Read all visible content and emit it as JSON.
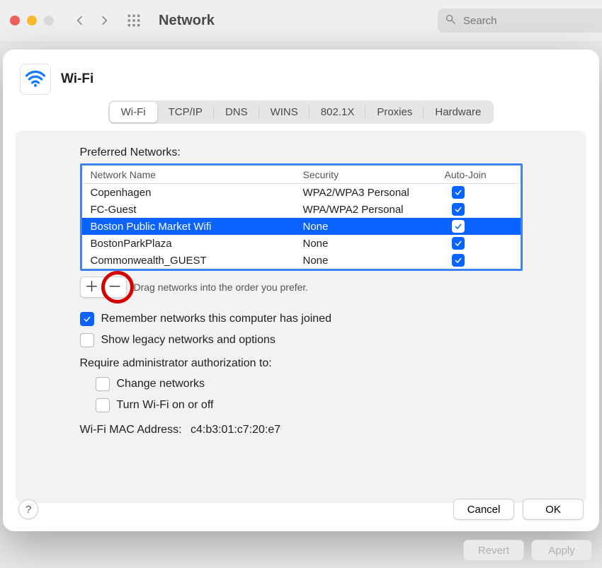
{
  "toolbar": {
    "title": "Network",
    "search_placeholder": "Search"
  },
  "sheet": {
    "title": "Wi-Fi",
    "tabs": [
      "Wi-Fi",
      "TCP/IP",
      "DNS",
      "WINS",
      "802.1X",
      "Proxies",
      "Hardware"
    ],
    "tabIndex": 0,
    "preferred_label": "Preferred Networks:",
    "columns": {
      "name": "Network Name",
      "security": "Security",
      "autojoin": "Auto-Join"
    },
    "networks": [
      {
        "name": "Copenhagen",
        "security": "WPA2/WPA3 Personal",
        "autojoin": true,
        "selected": false
      },
      {
        "name": "FC-Guest",
        "security": "WPA/WPA2 Personal",
        "autojoin": true,
        "selected": false
      },
      {
        "name": "Boston Public Market Wifi",
        "security": "None",
        "autojoin": true,
        "selected": true
      },
      {
        "name": "BostonParkPlaza",
        "security": "None",
        "autojoin": true,
        "selected": false
      },
      {
        "name": "Commonwealth_GUEST",
        "security": "None",
        "autojoin": true,
        "selected": false
      }
    ],
    "drag_hint": "Drag networks into the order you prefer.",
    "remember_label": "Remember networks this computer has joined",
    "remember_checked": true,
    "legacy_label": "Show legacy networks and options",
    "legacy_checked": false,
    "admin_label": "Require administrator authorization to:",
    "admin_change_label": "Change networks",
    "admin_change_checked": false,
    "admin_wifi_label": "Turn Wi-Fi on or off",
    "admin_wifi_checked": false,
    "mac_label": "Wi-Fi MAC Address:",
    "mac_value": "c4:b3:01:c7:20:e7",
    "buttons": {
      "cancel": "Cancel",
      "ok": "OK"
    }
  },
  "bg_buttons": {
    "revert": "Revert",
    "apply": "Apply"
  }
}
